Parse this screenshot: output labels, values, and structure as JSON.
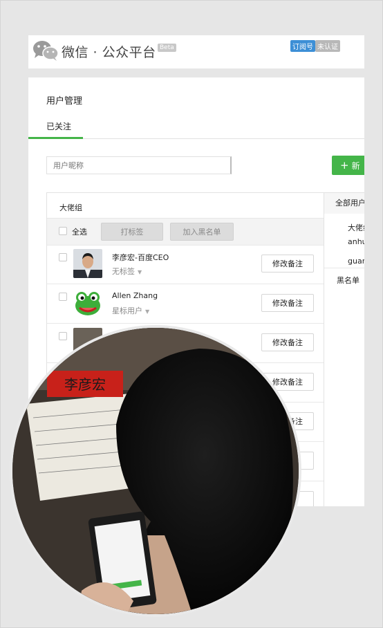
{
  "header": {
    "brand": "微信 · 公众平台",
    "beta": "Beta",
    "tag_subscription": "订阅号",
    "tag_unverified": "未认证"
  },
  "page": {
    "title": "用户管理",
    "tab_followed": "已关注"
  },
  "search": {
    "placeholder": "用户昵称"
  },
  "new_button": {
    "label": "新"
  },
  "group": {
    "title": "大佬组",
    "select_all": "全选",
    "tag_button": "打标签",
    "blacklist_button": "加入黑名单"
  },
  "users": [
    {
      "name": "李彦宏-百度CEO",
      "label": "无标签",
      "action": "修改备注"
    },
    {
      "name": "Allen Zhang",
      "label": "星标用户",
      "action": "修改备注"
    },
    {
      "name": "",
      "label": "",
      "action": "修改备注"
    },
    {
      "name": "",
      "label": "",
      "action": "修改备注"
    },
    {
      "name": "",
      "label": "",
      "action": "修改备注"
    },
    {
      "name": "",
      "label": "",
      "action": "注"
    },
    {
      "name": "",
      "label": "",
      "action": "注"
    }
  ],
  "sidebar": {
    "all_users": "全部用户",
    "group_1": "大佬组",
    "item_anhui": "anhui",
    "item_guan": "guan",
    "blacklist": "黑名单（"
  },
  "photo": {
    "nameplate": "李彦宏"
  },
  "colors": {
    "accent_green": "#44b549",
    "tag_blue": "#3d8fd6",
    "nameplate_red": "#c8211a"
  }
}
